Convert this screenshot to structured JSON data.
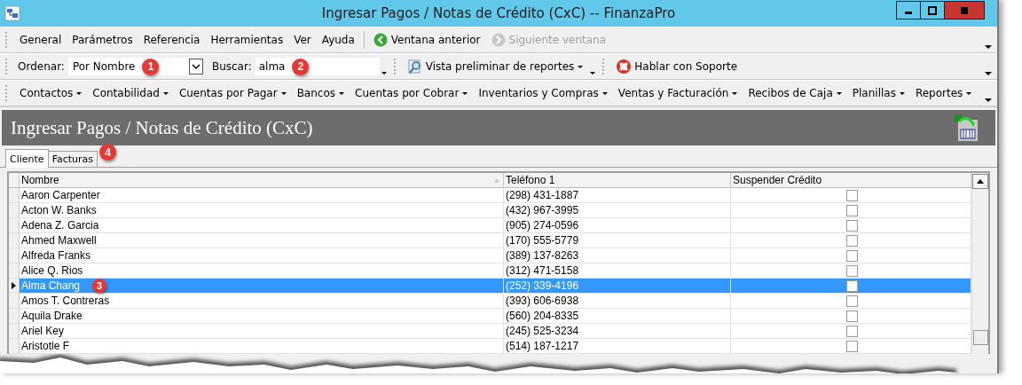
{
  "window": {
    "title": "Ingresar Pagos / Notas de Crédito (CxC) -- FinanzaPro"
  },
  "menu_bar": {
    "items": [
      "General",
      "Parámetros",
      "Referencia",
      "Herramientas",
      "Ver",
      "Ayuda"
    ],
    "nav_buttons": [
      {
        "label": "Ventana anterior",
        "disabled": false
      },
      {
        "label": "Siguiente ventana",
        "disabled": true
      }
    ]
  },
  "search_bar": {
    "sort_label": "Ordenar:",
    "sort_value": "Por Nombre",
    "sort_badge": "1",
    "search_label": "Buscar:",
    "search_value": "alma",
    "search_badge": "2",
    "report_preview": "Vista preliminar de reportes",
    "support": "Hablar con Soporte"
  },
  "module_menu": [
    "Contactos",
    "Contabilidad",
    "Cuentas por Pagar",
    "Bancos",
    "Cuentas por Cobrar",
    "Inventarios y Compras",
    "Ventas y Facturación",
    "Recibos de Caja",
    "Planillas",
    "Reportes"
  ],
  "header": {
    "title": "Ingresar Pagos / Notas de Crédito (CxC)"
  },
  "tabs": [
    {
      "label": "Cliente",
      "selected": true
    },
    {
      "label": "Facturas",
      "selected": false,
      "badge": "4"
    }
  ],
  "table": {
    "columns": [
      "Nombre",
      "Teléfono 1",
      "Suspender Crédito"
    ],
    "rows": [
      {
        "name": "Aaron Carpenter",
        "phone": "(298) 431-1887",
        "suspend_credit": false,
        "selected": false
      },
      {
        "name": "Acton W. Banks",
        "phone": "(432) 967-3995",
        "suspend_credit": false,
        "selected": false
      },
      {
        "name": "Adena Z. Garcia",
        "phone": "(905) 274-0596",
        "suspend_credit": false,
        "selected": false
      },
      {
        "name": "Ahmed Maxwell",
        "phone": "(170) 555-5779",
        "suspend_credit": false,
        "selected": false
      },
      {
        "name": "Alfreda Franks",
        "phone": "(389) 137-8263",
        "suspend_credit": false,
        "selected": false
      },
      {
        "name": "Alice Q. Rios",
        "phone": "(312) 471-5158",
        "suspend_credit": false,
        "selected": false
      },
      {
        "name": "Alma Chang",
        "phone": "(252) 339-4196",
        "suspend_credit": false,
        "selected": true,
        "badge": "3"
      },
      {
        "name": "Amos T. Contreras",
        "phone": "(393) 606-6938",
        "suspend_credit": false,
        "selected": false
      },
      {
        "name": "Aquila Drake",
        "phone": "(560) 204-8335",
        "suspend_credit": false,
        "selected": false
      },
      {
        "name": "Ariel Key",
        "phone": "(245) 525-3234",
        "suspend_credit": false,
        "selected": false
      },
      {
        "name": "Aristotle F",
        "phone": "(514) 187-1217",
        "suspend_credit": false,
        "selected": false
      }
    ]
  }
}
